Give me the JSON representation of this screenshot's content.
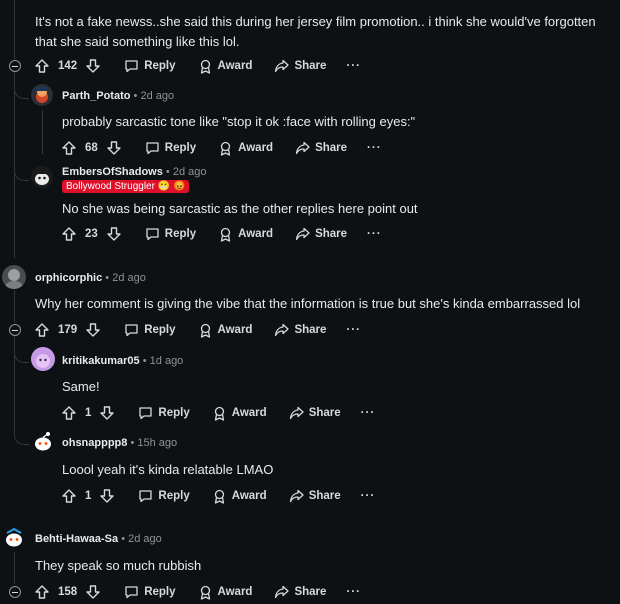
{
  "labels": {
    "reply": "Reply",
    "award": "Award",
    "share": "Share",
    "more": "···"
  },
  "comments": [
    {
      "id": "c0",
      "text": "It's not a fake newss..she said this during her jersey film promotion.. i think she would've forgotten that she said something like this lol.",
      "votes": "142"
    },
    {
      "id": "c1",
      "user": "Parth_Potato",
      "time": "2d ago",
      "text": "probably sarcastic tone like \"stop it ok :face with rolling eyes:\"",
      "votes": "68"
    },
    {
      "id": "c2",
      "user": "EmbersOfShadows",
      "time": "2d ago",
      "flair": "Bollywood Struggler 😬 😡",
      "text": "No she was being sarcastic as the other replies here point out",
      "votes": "23"
    },
    {
      "id": "c3",
      "user": "orphicorphic",
      "time": "2d ago",
      "text": "Why her comment is giving the vibe that the information is true but she's kinda embarrassed lol",
      "votes": "179"
    },
    {
      "id": "c4",
      "user": "kritikakumar05",
      "time": "1d ago",
      "text": "Same!",
      "votes": "1"
    },
    {
      "id": "c5",
      "user": "ohsnapppp8",
      "time": "15h ago",
      "text": "Loool yeah it's kinda relatable LMAO",
      "votes": "1"
    },
    {
      "id": "c6",
      "user": "Behti-Hawaa-Sa",
      "time": "2d ago",
      "text": "They speak so much rubbish",
      "votes": "158"
    }
  ]
}
